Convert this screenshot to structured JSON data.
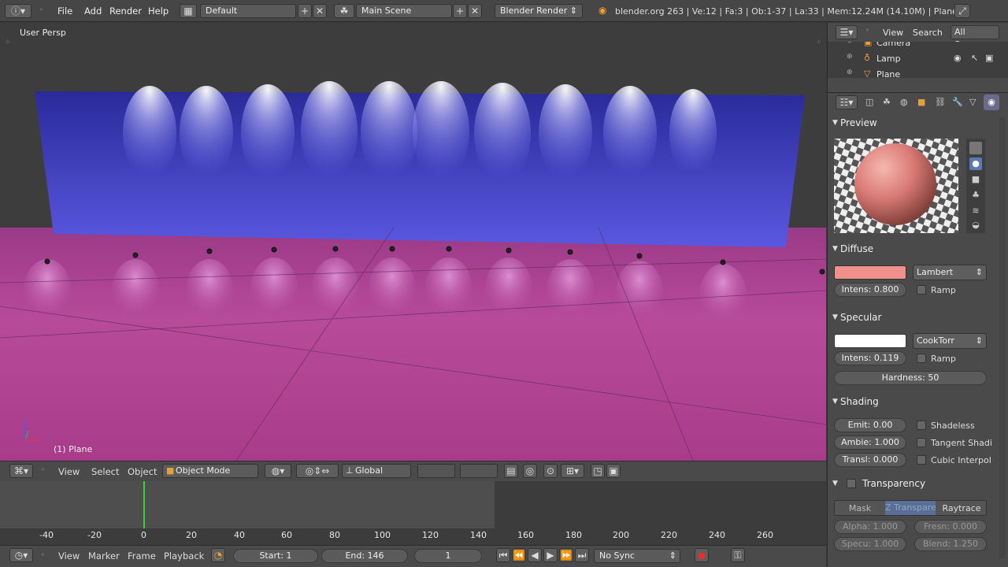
{
  "topbar": {
    "menus": [
      "File",
      "Add",
      "Render",
      "Help"
    ],
    "screen_layout": "Default",
    "scene": "Main Scene",
    "engine": "Blender Render",
    "stats": "blender.org 263 | Ve:12 | Fa:3 | Ob:1-37 | La:33 | Mem:12.24M (14.10M) | Plane"
  },
  "viewport": {
    "view_label": "User Persp",
    "object_label": "(1) Plane"
  },
  "view3d_header": {
    "menus": [
      "View",
      "Select",
      "Object"
    ],
    "mode": "Object Mode",
    "orientation": "Global"
  },
  "timeline": {
    "ticks": [
      "-40",
      "-20",
      "0",
      "20",
      "40",
      "60",
      "80",
      "100",
      "120",
      "140",
      "160",
      "180",
      "200",
      "220",
      "240",
      "260"
    ],
    "menus": [
      "View",
      "Marker",
      "Frame",
      "Playback"
    ],
    "start": "Start: 1",
    "end": "End: 146",
    "current": "1",
    "sync": "No Sync",
    "current_frame": 1
  },
  "outliner": {
    "menus": [
      "View",
      "Search"
    ],
    "filter": "All Scenes",
    "items": [
      "Camera",
      "Lamp",
      "Plane"
    ]
  },
  "material": {
    "preview_title": "Preview",
    "diffuse": {
      "title": "Diffuse",
      "color": "#f0908a",
      "shader": "Lambert",
      "intensity": "Intens: 0.800",
      "ramp": "Ramp"
    },
    "specular": {
      "title": "Specular",
      "color": "#ffffff",
      "shader": "CookTorr",
      "intensity": "Intens: 0.119",
      "ramp": "Ramp",
      "hardness": "Hardness: 50"
    },
    "shading": {
      "title": "Shading",
      "emit": "Emit: 0.00",
      "ambient": "Ambie: 1.000",
      "translucency": "Transl: 0.000",
      "shadeless": "Shadeless",
      "tangent": "Tangent Shadi",
      "cubic": "Cubic Interpol"
    },
    "transparency": {
      "title": "Transparency",
      "modes": [
        "Mask",
        "Z Transparen",
        "Raytrace"
      ],
      "alpha": "Alpha: 1.000",
      "fresnel": "Fresn: 0.000",
      "specular": "Specu: 1.000",
      "blend": "Blend: 1.250"
    }
  }
}
